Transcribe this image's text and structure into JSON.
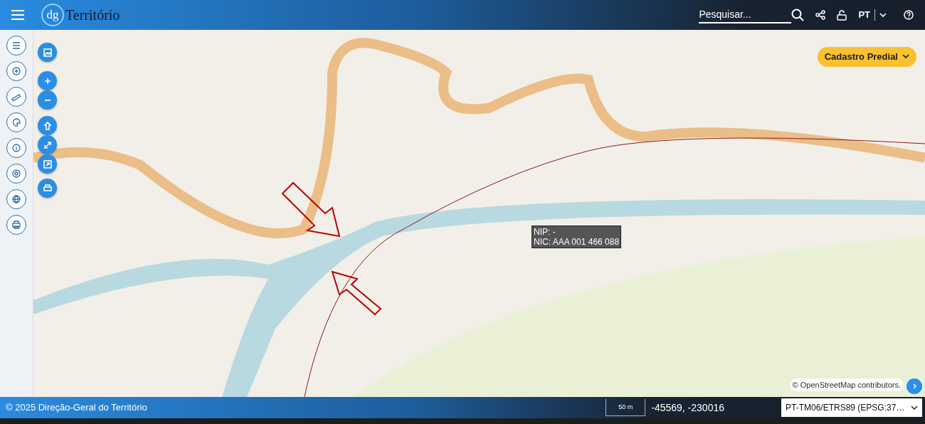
{
  "header": {
    "logo_mark": "dg",
    "logo_text": "Território",
    "search": {
      "placeholder": "Pesquisar..."
    },
    "language": "PT"
  },
  "map": {
    "layer_select": "Cadastro Predial",
    "tooltip": [
      "NIP: -",
      "NIC: AAA 001 466 088"
    ],
    "attribution": "© OpenStreetMap contributors."
  },
  "footer": {
    "copyright": "© 2025 Direção-Geral do Território",
    "scale": "50 m",
    "coordinates": "-45569, -230016",
    "projection": "PT-TM06/ETRS89 (EPSG:37…"
  }
}
